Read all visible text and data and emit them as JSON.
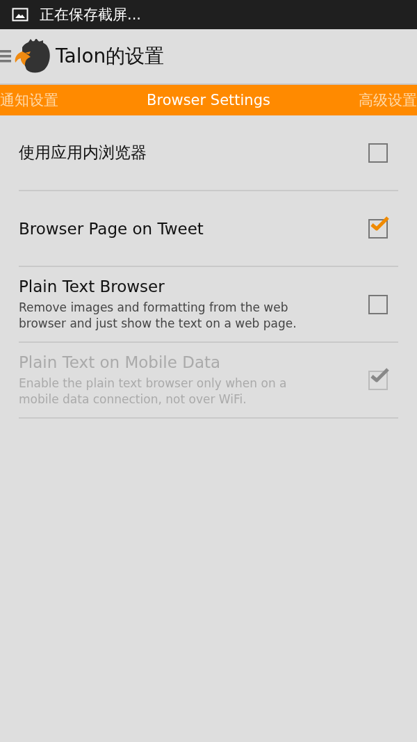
{
  "status_bar": {
    "notification": "正在保存截屏..."
  },
  "action_bar": {
    "title": "Talon的设置"
  },
  "tabs": [
    {
      "label": "通知设置",
      "selected": false
    },
    {
      "label": "Browser Settings",
      "selected": true
    },
    {
      "label": "高级设置",
      "selected": false
    }
  ],
  "preferences": [
    {
      "title": "使用应用内浏览器",
      "checked": false,
      "disabled": false
    },
    {
      "title": "Browser Page on Tweet",
      "checked": true,
      "disabled": false
    },
    {
      "title": "Plain Text Browser",
      "summary": "Remove images and formatting from the web browser and just show the text on a web page.",
      "checked": false,
      "disabled": false
    },
    {
      "title": "Plain Text on Mobile Data",
      "summary": "Enable the plain text browser only when on a mobile data connection, not over WiFi.",
      "checked": true,
      "disabled": true
    }
  ]
}
